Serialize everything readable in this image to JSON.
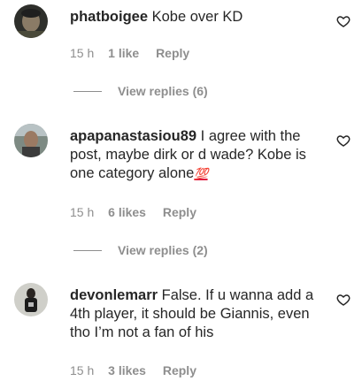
{
  "comments": [
    {
      "username": "phatboigee",
      "text": "Kobe over KD",
      "time": "15 h",
      "likes": "1 like",
      "reply": "Reply",
      "view_replies": "View replies (6)",
      "avatar_icon": "user-avatar-icon"
    },
    {
      "username": "apapanastasiou89",
      "text": "I agree with the post, maybe dirk or d wade? Kobe is one category alone",
      "emoji": "💯",
      "time": "15 h",
      "likes": "6 likes",
      "reply": "Reply",
      "view_replies": "View replies (2)",
      "avatar_icon": "user-avatar-icon"
    },
    {
      "username": "devonlemarr",
      "text": "False. If u wanna add a 4th player, it should be Giannis, even tho I’m not a fan of his",
      "time": "15 h",
      "likes": "3 likes",
      "reply": "Reply",
      "avatar_icon": "user-avatar-icon"
    }
  ],
  "colors": {
    "text": "#262626",
    "muted": "#8e8e8e",
    "emoji_red": "#e0163b"
  },
  "icons": {
    "like": "heart-outline-icon"
  }
}
